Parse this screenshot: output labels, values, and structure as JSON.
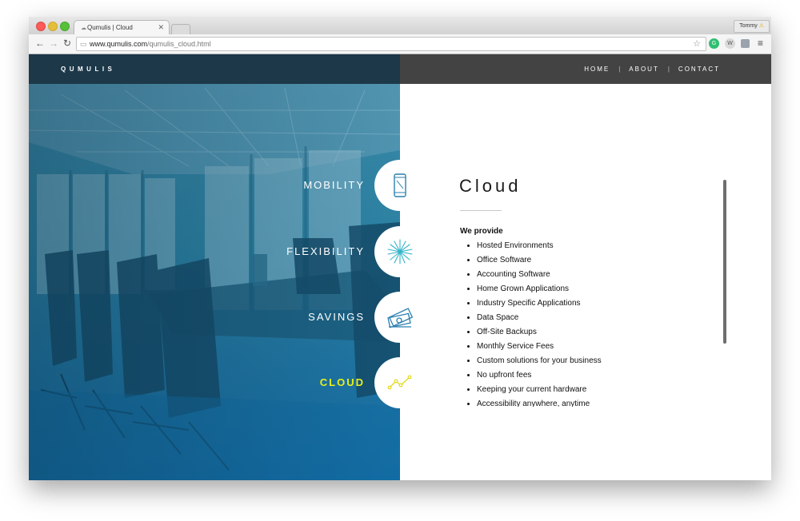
{
  "browser": {
    "tab_title": "Qumulis | Cloud",
    "url_host": "www.qumulis.com",
    "url_path": "/qumulis_cloud.html",
    "profile_name": "Tommy"
  },
  "site": {
    "brand": "QUMULIS",
    "nav": [
      "HOME",
      "ABOUT",
      "CONTACT"
    ],
    "features": [
      {
        "label": "MOBILITY",
        "icon": "phone-icon",
        "active": false
      },
      {
        "label": "FLEXIBILITY",
        "icon": "starburst-icon",
        "active": false
      },
      {
        "label": "SAVINGS",
        "icon": "money-icon",
        "active": false
      },
      {
        "label": "CLOUD",
        "icon": "line-graph-icon",
        "active": true
      }
    ],
    "section_title": "Cloud",
    "list_heading": "We provide",
    "list_items": [
      "Hosted Environments",
      "Office Software",
      "Accounting Software",
      "Home Grown Applications",
      "Industry Specific Applications",
      "Data Space",
      "Off-Site Backups",
      "Monthly Service Fees",
      "Custom solutions for your business",
      "No upfront fees",
      "Keeping your current hardware",
      "Accessibility anywhere, anytime"
    ]
  },
  "colors": {
    "hero_blue": "#1f78a8",
    "header_dark": "#434343",
    "active_label": "#e9f01b",
    "icon_stroke": "#2a7fb0"
  }
}
